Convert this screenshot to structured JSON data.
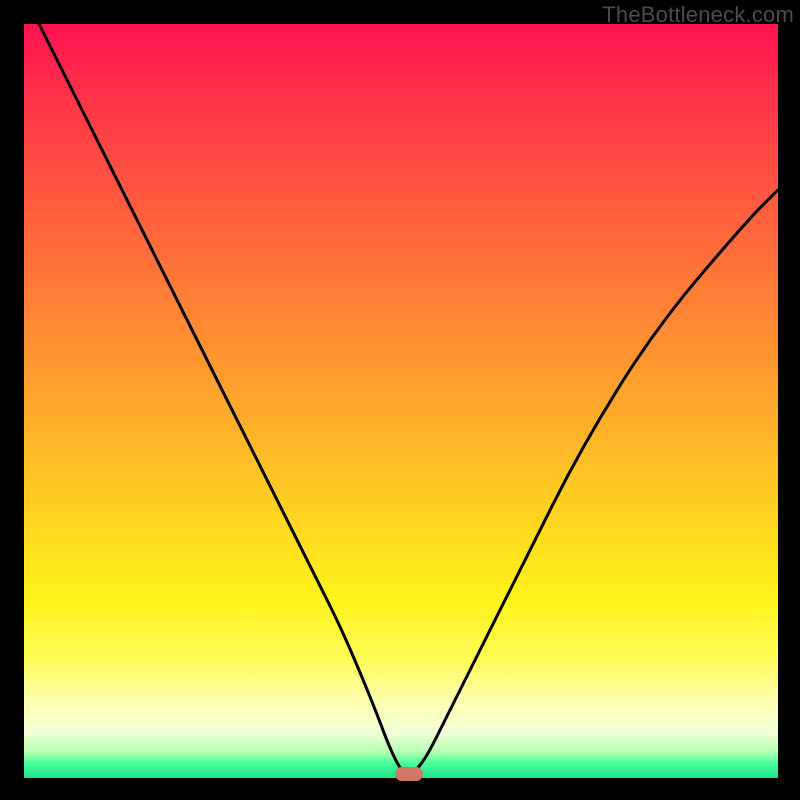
{
  "watermark": "TheBottleneck.com",
  "colors": {
    "frame": "#000000",
    "curve": "#000000",
    "marker": "#cf7a67",
    "gradient_stops": [
      "#ff1152",
      "#ff2e4a",
      "#ff5640",
      "#ff7e36",
      "#ffa62c",
      "#ffd022",
      "#fff31a",
      "#fffc55",
      "#fdffb0",
      "#f2ffd8",
      "#b7ffb2",
      "#49ff9b",
      "#19e48a"
    ]
  },
  "chart_data": {
    "type": "line",
    "title": "",
    "xlabel": "",
    "ylabel": "",
    "xlim": [
      0,
      100
    ],
    "ylim": [
      0,
      100
    ],
    "grid": false,
    "legend": false,
    "series": [
      {
        "name": "bottleneck-curve",
        "x": [
          2,
          6,
          10,
          14,
          18,
          22,
          26,
          30,
          34,
          38,
          42,
          45,
          47,
          48.5,
          50,
          51,
          52,
          53.5,
          56,
          60,
          66,
          74,
          84,
          96,
          100
        ],
        "values": [
          100,
          92,
          84,
          76,
          68,
          60,
          52,
          44,
          36,
          28,
          20,
          13,
          8,
          4,
          1,
          0.5,
          1,
          3,
          8,
          16,
          28,
          44,
          60,
          74,
          78
        ]
      }
    ],
    "annotations": [
      {
        "name": "min-marker",
        "x": 51,
        "y": 0.5,
        "shape": "rounded-rect",
        "color": "#cf7a67"
      }
    ],
    "note": "Axis ticks and numeric labels are not shown in the image; x/y values above are estimated from pixel positions on a 0–100 normalized scale."
  }
}
